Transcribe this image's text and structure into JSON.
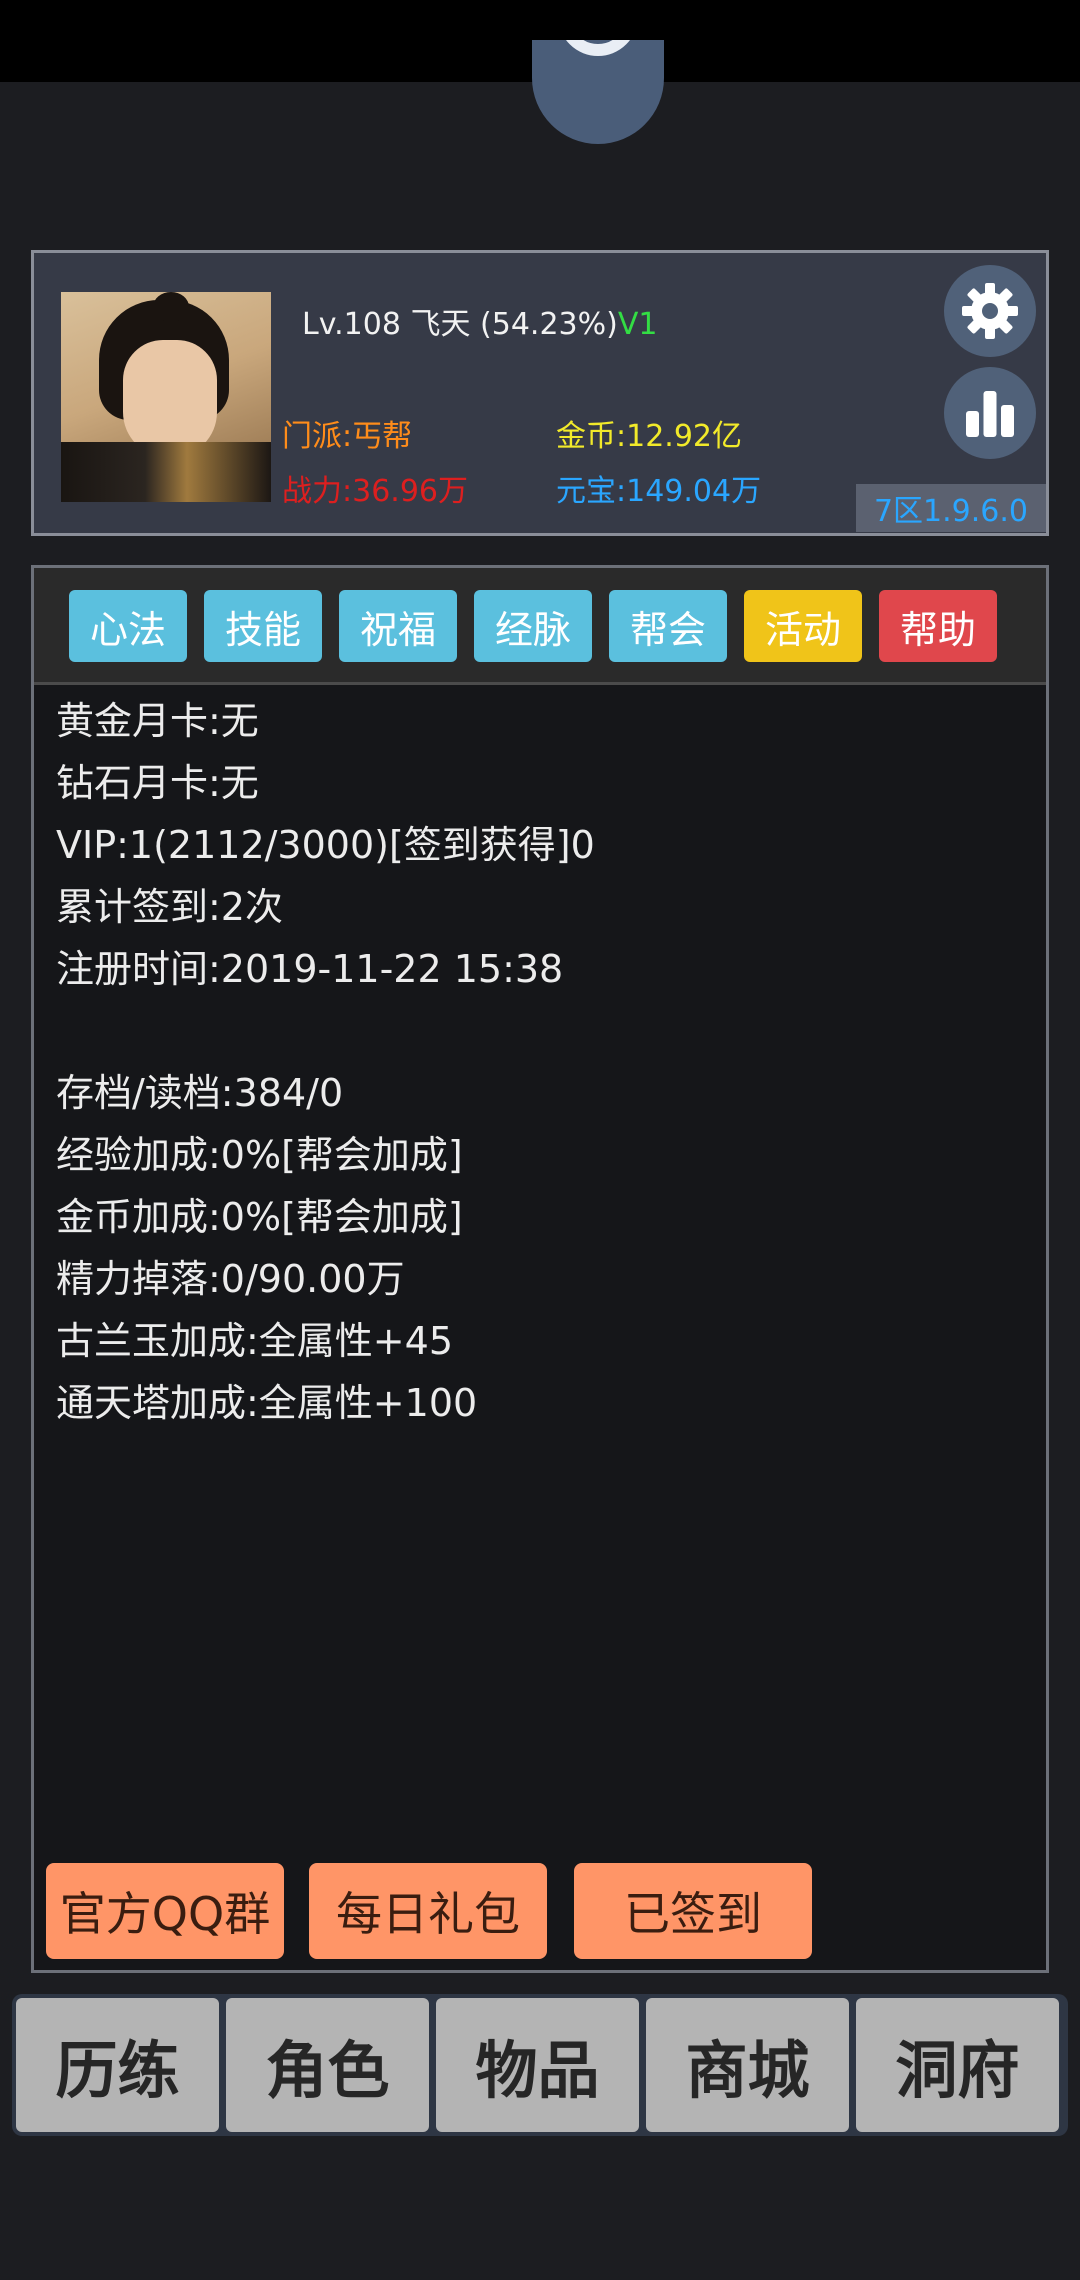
{
  "profile": {
    "level": "Lv.108",
    "name": "飞天",
    "exp_percent": "(54.23%)",
    "vip": "V1",
    "sect": "门派:丐帮",
    "power": "战力:36.96万",
    "gold": "金币:12.92亿",
    "yuanbao": "元宝:149.04万",
    "zone_version": "7区1.9.6.0"
  },
  "icons": {
    "settings": "gear-icon",
    "ranking": "bar-chart-icon",
    "top": "at-sign-icon"
  },
  "tabs": [
    {
      "label": "心法",
      "color": "#5bc0de"
    },
    {
      "label": "技能",
      "color": "#5bc0de"
    },
    {
      "label": "祝福",
      "color": "#5bc0de"
    },
    {
      "label": "经脉",
      "color": "#5bc0de"
    },
    {
      "label": "帮会",
      "color": "#5bc0de"
    },
    {
      "label": "活动",
      "color": "#f0c419"
    },
    {
      "label": "帮助",
      "color": "#e0474c"
    }
  ],
  "info_lines": [
    "黄金月卡:无",
    "钻石月卡:无",
    "VIP:1(2112/3000)[签到获得]0",
    "累计签到:2次",
    "注册时间:2019-11-22 15:38",
    "",
    "存档/读档:384/0",
    "经验加成:0%[帮会加成]",
    "金币加成:0%[帮会加成]",
    "精力掉落:0/90.00万",
    "古兰玉加成:全属性+45",
    "通天塔加成:全属性+100"
  ],
  "actions": [
    "官方QQ群",
    "每日礼包",
    "已签到"
  ],
  "bottom_nav": [
    "历练",
    "角色",
    "物品",
    "商城",
    "洞府"
  ],
  "colors": {
    "sect": "#ff8c1a",
    "power": "#dd1f1f",
    "gold": "#f2ea2a",
    "yuanbao": "#2aa6ff",
    "vip": "#33dd44"
  }
}
